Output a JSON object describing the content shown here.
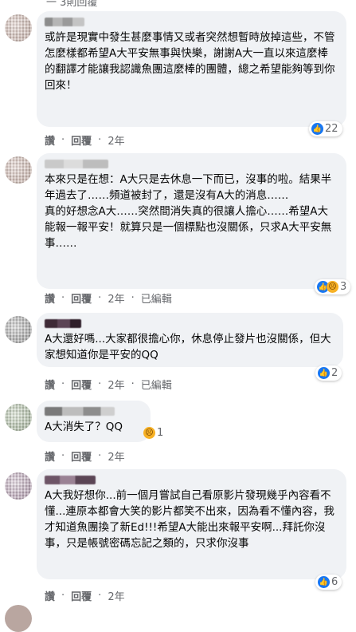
{
  "top_fragment": "一 3則回覆",
  "comments": [
    {
      "text": "或許是現實中發生甚麼事情又或者突然想暫時放掉這些，不管怎麼樣都希望A大平安無事與快樂，謝謝A大一直以來這麼棒的翻譯才能讓我認識魚團這麼棒的團體，總之希望能夠等到你回來！",
      "reaction_count": "22",
      "like_label": "讚",
      "reply_label": "回覆",
      "time": "2年",
      "edited": ""
    },
    {
      "text": "本來只是在想：A大只是去休息一下而已，沒事的啦。結果半年過去了……頻道被封了，還是沒有A大的消息……\n真的好想念A大……突然間消失真的很讓人擔心……希望A大能報一報平安！就算只是一個標點也沒關係，只求A大平安無事……",
      "reaction_count": "3",
      "like_label": "讚",
      "reply_label": "回覆",
      "time": "2年",
      "edited": "已編輯"
    },
    {
      "text": "A大還好嗎...大家都很擔心你，休息停止發片也沒關係，但大家想知道你是平安的QQ",
      "reaction_count": "2",
      "like_label": "讚",
      "reply_label": "回覆",
      "time": "2年",
      "edited": "已編輯"
    },
    {
      "text": "A大消失了？QQ",
      "reaction_count": "1",
      "like_label": "讚",
      "reply_label": "回覆",
      "time": "2年",
      "edited": ""
    },
    {
      "text": "A大我好想你...前一個月嘗試自己看原影片發現幾乎內容看不懂...連原本都會大笑的影片都笑不出來，因為看不懂內容，我才知道魚團換了新Ed!!!希望A大能出來報平安啊...拜託你沒事，只是帳號密碼忘記之類的，只求你沒事",
      "reaction_count": "6",
      "like_label": "讚",
      "reply_label": "回覆",
      "time": "2年",
      "edited": ""
    }
  ],
  "colors": {
    "bubble": "#f0f2f5",
    "like": "#1877f2",
    "meta": "#65676b"
  }
}
